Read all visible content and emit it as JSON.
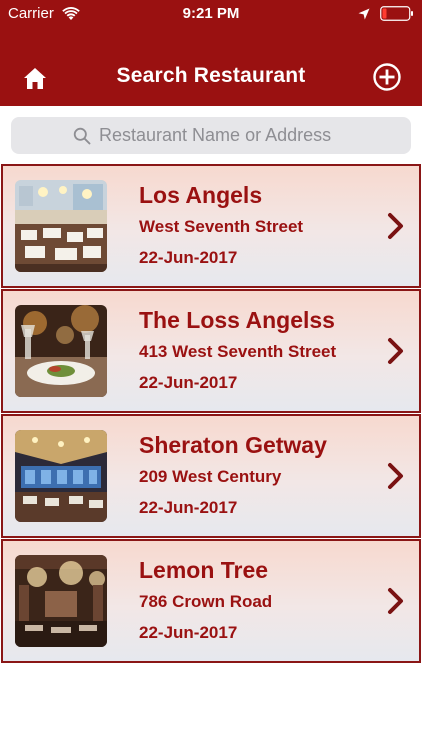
{
  "status_bar": {
    "carrier": "Carrier",
    "time": "9:21 PM"
  },
  "nav": {
    "title": "Search Restaurant",
    "left_icon": "home-icon",
    "right_icon": "plus-circle-icon"
  },
  "search": {
    "placeholder": "Restaurant Name or Address",
    "value": ""
  },
  "colors": {
    "brand": "#9a1111",
    "card_border": "#8a1616",
    "text_accent": "#9a1111"
  },
  "restaurants": [
    {
      "name": "Los Angels",
      "address": "West Seventh Street",
      "date": "22-Jun-2017"
    },
    {
      "name": "The Loss Angelss",
      "address": "413 West Seventh Street",
      "date": "22-Jun-2017"
    },
    {
      "name": "Sheraton Getway",
      "address": "209 West Century",
      "date": "22-Jun-2017"
    },
    {
      "name": "Lemon Tree",
      "address": "786 Crown Road",
      "date": "22-Jun-2017"
    }
  ]
}
